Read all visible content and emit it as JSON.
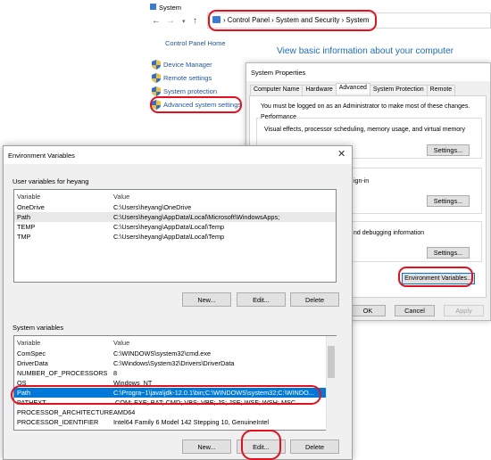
{
  "system_window": {
    "title": "System",
    "nav": {
      "back": "←",
      "forward": "→",
      "dropdown": "▾",
      "up": "↑"
    },
    "breadcrumb": "›  Control Panel  ›  System and Security  ›  System",
    "control_panel_home": "Control Panel Home",
    "header": "View basic information about your computer",
    "tasks": [
      {
        "label": "Device Manager"
      },
      {
        "label": "Remote settings"
      },
      {
        "label": "System protection"
      },
      {
        "label": "Advanced system settings"
      }
    ]
  },
  "system_properties": {
    "title": "System Properties",
    "tabs": [
      "Computer Name",
      "Hardware",
      "Advanced",
      "System Protection",
      "Remote"
    ],
    "active_tab": "Advanced",
    "admin_note": "You must be logged on as an Administrator to make most of these changes.",
    "performance": {
      "label": "Performance",
      "description": "Visual effects, processor scheduling, memory usage, and virtual memory",
      "settings_button": "Settings..."
    },
    "profiles": {
      "label_fragment": "ign-in",
      "settings_button": "Settings..."
    },
    "startup": {
      "label_fragment": "nd debugging information",
      "settings_button": "Settings..."
    },
    "env_vars_button": "Environment Variables...",
    "ok_button": "OK",
    "cancel_button": "Cancel",
    "apply_button": "Apply"
  },
  "env_dialog": {
    "title": "Environment Variables",
    "close": "✕",
    "user_section_label": "User variables for heyang",
    "system_section_label": "System variables",
    "columns": {
      "variable": "Variable",
      "value": "Value"
    },
    "user_vars": [
      {
        "variable": "OneDrive",
        "value": "C:\\Users\\heyang\\OneDrive"
      },
      {
        "variable": "Path",
        "value": "C:\\Users\\heyang\\AppData\\Local\\Microsoft\\WindowsApps;"
      },
      {
        "variable": "TEMP",
        "value": "C:\\Users\\heyang\\AppData\\Local\\Temp"
      },
      {
        "variable": "TMP",
        "value": "C:\\Users\\heyang\\AppData\\Local\\Temp"
      }
    ],
    "user_buttons": {
      "new": "New...",
      "edit": "Edit...",
      "delete": "Delete"
    },
    "system_vars": [
      {
        "variable": "ComSpec",
        "value": "C:\\WINDOWS\\system32\\cmd.exe"
      },
      {
        "variable": "DriverData",
        "value": "C:\\Windows\\System32\\Drivers\\DriverData"
      },
      {
        "variable": "NUMBER_OF_PROCESSORS",
        "value": "8"
      },
      {
        "variable": "OS",
        "value": "Windows_NT"
      },
      {
        "variable": "Path",
        "value": "C:\\Progra~1\\java\\jdk-12.0.1\\bin;C:\\WINDOWS\\system32;C:\\WINDO..."
      },
      {
        "variable": "PATHEXT",
        "value": ".COM;.EXE;.BAT;.CMD;.VBS;.VBE;.JS;.JSE;.WSF;.WSH;.MSC"
      },
      {
        "variable": "PROCESSOR_ARCHITECTURE",
        "value": "AMD64"
      },
      {
        "variable": "PROCESSOR_IDENTIFIER",
        "value": "Intel64 Family 6 Model 142 Stepping 10, GenuineIntel"
      }
    ],
    "system_buttons": {
      "new": "New...",
      "edit": "Edit...",
      "delete": "Delete"
    }
  },
  "colors": {
    "annotation_red": "#e60f1e",
    "selection_blue": "#0078d7",
    "link_blue": "#1e55a5"
  }
}
